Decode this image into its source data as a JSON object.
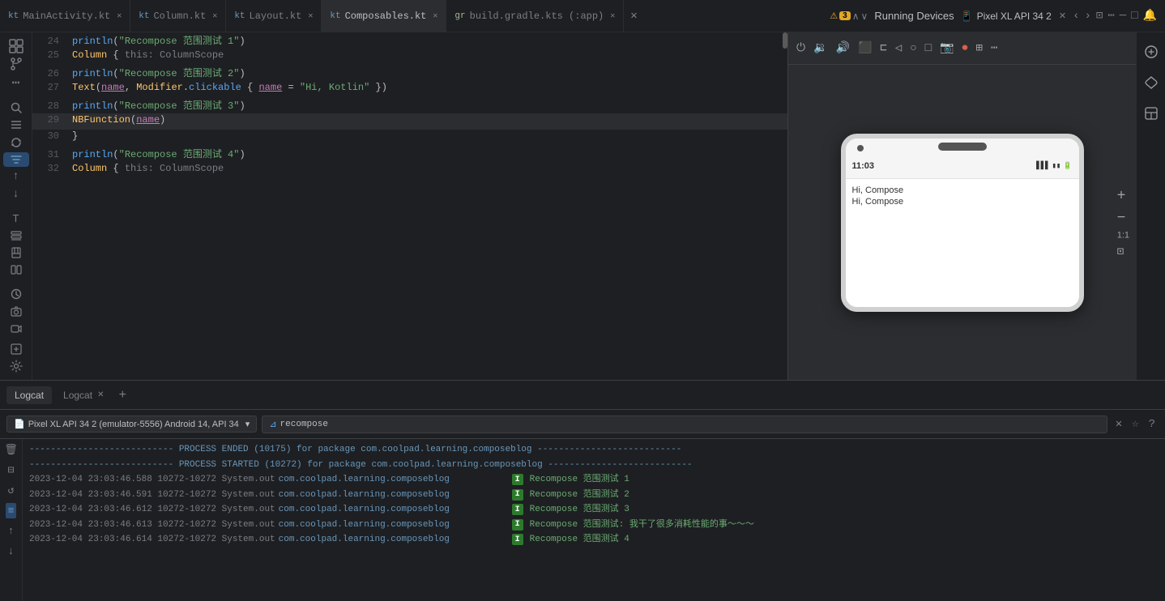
{
  "tabs": [
    {
      "id": "main",
      "icon": "kt",
      "label": "MainActivity.kt",
      "closable": true,
      "active": false
    },
    {
      "id": "column",
      "icon": "kt",
      "label": "Column.kt",
      "closable": true,
      "active": false
    },
    {
      "id": "layout",
      "icon": "kt",
      "label": "Layout.kt",
      "closable": true,
      "active": false
    },
    {
      "id": "composables",
      "icon": "kt",
      "label": "Composables.kt",
      "closable": true,
      "active": false
    },
    {
      "id": "build",
      "icon": "gradle",
      "label": "build.gradle.kts (:app)",
      "closable": true,
      "active": false
    }
  ],
  "running_devices": "Running Devices",
  "pixel_tab": {
    "label": "Pixel XL API 34 2",
    "closable": true
  },
  "emulator": {
    "phone_time": "11:03",
    "compose_text_1": "Hi, Compose",
    "compose_text_2": "Hi, Compose",
    "zoom_level": "1:1"
  },
  "code": {
    "lines": [
      {
        "num": "24",
        "tokens": [
          {
            "type": "plain",
            "text": "    "
          },
          {
            "type": "fn",
            "text": "println"
          },
          {
            "type": "plain",
            "text": "("
          },
          {
            "type": "str",
            "text": "\"Recompose 范围测试 1\""
          },
          {
            "type": "plain",
            "text": ")"
          }
        ]
      },
      {
        "num": "25",
        "tokens": [
          {
            "type": "plain",
            "text": "    "
          },
          {
            "type": "cls",
            "text": "Column"
          },
          {
            "type": "plain",
            "text": " { "
          },
          {
            "type": "cm",
            "text": "this: ColumnScope"
          }
        ]
      },
      {
        "num": "26",
        "tokens": [
          {
            "type": "plain",
            "text": "        "
          },
          {
            "type": "fn",
            "text": "println"
          },
          {
            "type": "plain",
            "text": "("
          },
          {
            "type": "str",
            "text": "\"Recompose 范围测试 2\""
          },
          {
            "type": "plain",
            "text": ")"
          }
        ]
      },
      {
        "num": "27",
        "tokens": [
          {
            "type": "plain",
            "text": "        "
          },
          {
            "type": "cls",
            "text": "Text"
          },
          {
            "type": "plain",
            "text": "("
          },
          {
            "type": "param",
            "text": "name"
          },
          {
            "type": "plain",
            "text": ", "
          },
          {
            "type": "cls",
            "text": "Modifier"
          },
          {
            "type": "plain",
            "text": "."
          },
          {
            "type": "fn",
            "text": "clickable"
          },
          {
            "type": "plain",
            "text": "{ "
          },
          {
            "type": "param",
            "text": "name"
          },
          {
            "type": "plain",
            "text": " = "
          },
          {
            "type": "str",
            "text": "\"Hi, Kotlin\""
          },
          {
            "type": "plain",
            "text": " })"
          }
        ]
      },
      {
        "num": "28",
        "tokens": [
          {
            "type": "plain",
            "text": "        "
          },
          {
            "type": "fn",
            "text": "println"
          },
          {
            "type": "plain",
            "text": "("
          },
          {
            "type": "str",
            "text": "\"Recompose 范围测试 3\""
          },
          {
            "type": "plain",
            "text": ")"
          }
        ]
      },
      {
        "num": "29",
        "highlight": true,
        "tokens": [
          {
            "type": "plain",
            "text": "        "
          },
          {
            "type": "cls",
            "text": "NBFunction"
          },
          {
            "type": "plain",
            "text": "("
          },
          {
            "type": "param",
            "text": "name"
          },
          {
            "type": "plain",
            "text": ")"
          }
        ]
      },
      {
        "num": "30",
        "tokens": [
          {
            "type": "plain",
            "text": "    }"
          }
        ]
      },
      {
        "num": "31",
        "tokens": [
          {
            "type": "plain",
            "text": "    "
          },
          {
            "type": "fn",
            "text": "println"
          },
          {
            "type": "plain",
            "text": "("
          },
          {
            "type": "str",
            "text": "\"Recompose 范围测试 4\""
          },
          {
            "type": "plain",
            "text": ")"
          }
        ]
      },
      {
        "num": "32",
        "tokens": [
          {
            "type": "plain",
            "text": "    "
          },
          {
            "type": "cls",
            "text": "Column"
          },
          {
            "type": "plain",
            "text": " { "
          },
          {
            "type": "cm",
            "text": "this: ColumnScope"
          }
        ]
      }
    ]
  },
  "warning": {
    "count": "3",
    "icon": "⚠"
  },
  "logcat": {
    "tabs": [
      {
        "label": "Logcat",
        "active": true,
        "closable": false
      },
      {
        "label": "Logcat",
        "active": false,
        "closable": true
      }
    ],
    "device_selector": "Pixel XL API 34 2 (emulator-5556) Android 14, API 34",
    "filter_text": "recompose",
    "separator_lines": [
      "--------------------------- PROCESS ENDED (10175) for package com.coolpad.learning.composeblog ---------------------------",
      "--------------------------- PROCESS STARTED (10272) for package com.coolpad.learning.composeblog ---------------------------"
    ],
    "log_entries": [
      {
        "timestamp": "2023-12-04 23:03:46.588",
        "pid": "10272-10272",
        "tag": "System.out",
        "package": "com.coolpad.learning.composeblog",
        "level": "I",
        "message": "Recompose 范围测试 1"
      },
      {
        "timestamp": "2023-12-04 23:03:46.591",
        "pid": "10272-10272",
        "tag": "System.out",
        "package": "com.coolpad.learning.composeblog",
        "level": "I",
        "message": "Recompose 范围测试 2"
      },
      {
        "timestamp": "2023-12-04 23:03:46.612",
        "pid": "10272-10272",
        "tag": "System.out",
        "package": "com.coolpad.learning.composeblog",
        "level": "I",
        "message": "Recompose 范围测试 3"
      },
      {
        "timestamp": "2023-12-04 23:03:46.613",
        "pid": "10272-10272",
        "tag": "System.out",
        "package": "com.coolpad.learning.composeblog",
        "level": "I",
        "message": "Recompose 范围测试: 我干了很多消耗性能的事～～～"
      },
      {
        "timestamp": "2023-12-04 23:03:46.614",
        "pid": "10272-10272",
        "tag": "System.out",
        "package": "com.coolpad.learning.composeblog",
        "level": "I",
        "message": "Recompose 范围测试 4"
      }
    ]
  },
  "sidebar": {
    "icons": [
      {
        "name": "project-icon",
        "glyph": "📁"
      },
      {
        "name": "git-icon",
        "glyph": "⑂"
      },
      {
        "name": "more-icon",
        "glyph": "⋯"
      },
      {
        "name": "search-icon",
        "glyph": "🔍"
      },
      {
        "name": "structure-icon",
        "glyph": "≡"
      },
      {
        "name": "refresh-icon",
        "glyph": "↺"
      },
      {
        "name": "filter-icon",
        "glyph": "⊟"
      },
      {
        "name": "up-icon",
        "glyph": "↑"
      },
      {
        "name": "down-icon",
        "glyph": "↓"
      },
      {
        "name": "format-icon",
        "glyph": "T"
      },
      {
        "name": "list-icon",
        "glyph": "☰"
      },
      {
        "name": "bookmark-icon",
        "glyph": "⊞"
      },
      {
        "name": "columns-icon",
        "glyph": "⊟"
      },
      {
        "name": "history-icon",
        "glyph": "⊙"
      },
      {
        "name": "camera-icon",
        "glyph": "📷"
      },
      {
        "name": "video-icon",
        "glyph": "📹"
      }
    ]
  }
}
